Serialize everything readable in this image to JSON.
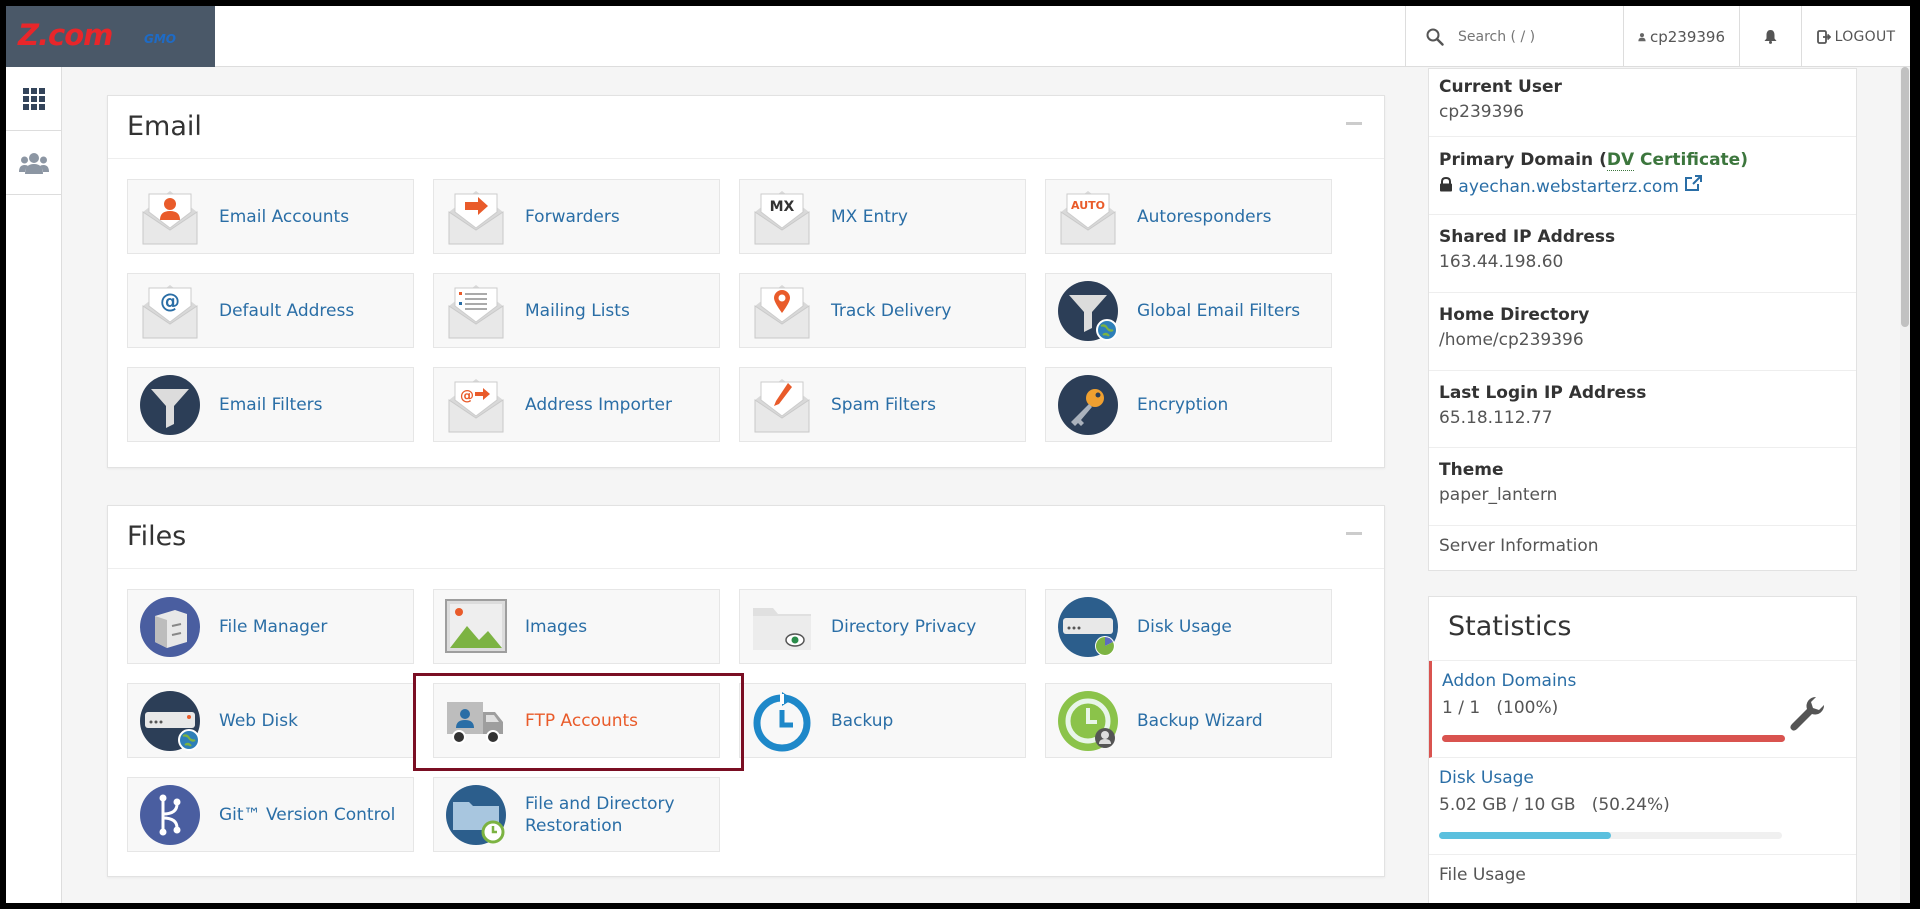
{
  "header": {
    "logo_main": "Z.com",
    "logo_sub": "GMO",
    "search_placeholder": "Search ( / )",
    "username": "cp239396",
    "logout_label": "LOGOUT"
  },
  "email_section": {
    "title": "Email",
    "items": [
      {
        "label": "Email Accounts",
        "icon": "envelope-user-icon"
      },
      {
        "label": "Forwarders",
        "icon": "envelope-arrow-icon"
      },
      {
        "label": "MX Entry",
        "icon": "envelope-mx-icon",
        "badge": "MX"
      },
      {
        "label": "Autoresponders",
        "icon": "envelope-auto-icon",
        "badge": "AUTO"
      },
      {
        "label": "Default Address",
        "icon": "envelope-at-icon",
        "badge": "@"
      },
      {
        "label": "Mailing Lists",
        "icon": "envelope-list-icon"
      },
      {
        "label": "Track Delivery",
        "icon": "envelope-pin-icon"
      },
      {
        "label": "Global Email Filters",
        "icon": "funnel-globe-icon"
      },
      {
        "label": "Email Filters",
        "icon": "funnel-icon"
      },
      {
        "label": "Address Importer",
        "icon": "envelope-import-icon"
      },
      {
        "label": "Spam Filters",
        "icon": "envelope-pen-icon"
      },
      {
        "label": "Encryption",
        "icon": "key-icon"
      }
    ]
  },
  "files_section": {
    "title": "Files",
    "items": [
      {
        "label": "File Manager",
        "icon": "file-cabinet-icon"
      },
      {
        "label": "Images",
        "icon": "image-icon"
      },
      {
        "label": "Directory Privacy",
        "icon": "folder-eye-icon"
      },
      {
        "label": "Disk Usage",
        "icon": "disk-chart-icon"
      },
      {
        "label": "Web Disk",
        "icon": "disk-globe-icon"
      },
      {
        "label": "FTP Accounts",
        "icon": "ftp-truck-icon"
      },
      {
        "label": "Backup",
        "icon": "backup-clock-icon"
      },
      {
        "label": "Backup Wizard",
        "icon": "backup-wizard-icon"
      },
      {
        "label": "Git™ Version Control",
        "icon": "git-branch-icon"
      },
      {
        "label": "File and Directory Restoration",
        "icon": "folder-clock-icon"
      }
    ]
  },
  "general_info": {
    "current_user_label": "Current User",
    "current_user": "cp239396",
    "primary_domain_label": "Primary Domain (",
    "primary_domain_dv": "DV",
    "primary_domain_cert": " Certificate)",
    "primary_domain": "ayechan.webstarterz.com",
    "shared_ip_label": "Shared IP Address",
    "shared_ip": "163.44.198.60",
    "home_dir_label": "Home Directory",
    "home_dir": "/home/cp239396",
    "last_login_label": "Last Login IP Address",
    "last_login": "65.18.112.77",
    "theme_label": "Theme",
    "theme": "paper_lantern",
    "server_info_link": "Server Information"
  },
  "statistics": {
    "title": "Statistics",
    "items": [
      {
        "name": "Addon Domains",
        "usage": "1 / 1   (100%)",
        "percent": 100,
        "color": "#d9534f"
      },
      {
        "name": "Disk Usage",
        "usage": "5.02 GB / 10 GB   (50.24%)",
        "percent": 50.24,
        "color": "#5bc0de"
      },
      {
        "name": "File Usage",
        "usage": "",
        "percent": 0,
        "color": "#5bc0de"
      }
    ]
  }
}
